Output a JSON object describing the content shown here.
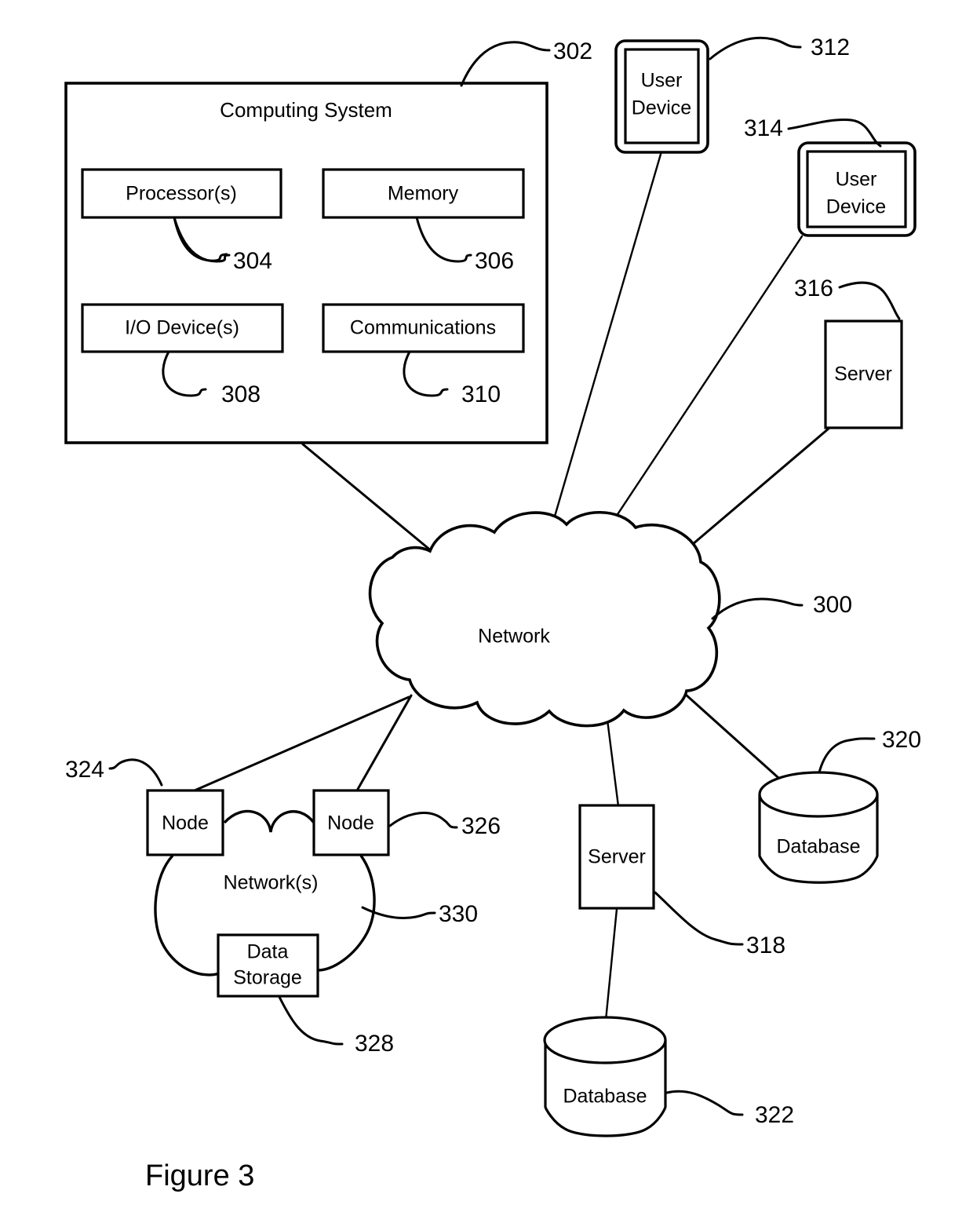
{
  "figure": {
    "caption": "Figure 3"
  },
  "computing_system": {
    "title": "Computing System",
    "ref": "302",
    "components": [
      {
        "label": "Processor(s)",
        "ref": "304"
      },
      {
        "label": "Memory",
        "ref": "306"
      },
      {
        "label": "I/O Device(s)",
        "ref": "308"
      },
      {
        "label": "Communications",
        "ref": "310"
      }
    ]
  },
  "user_devices": [
    {
      "line1": "User",
      "line2": "Device",
      "ref": "312"
    },
    {
      "line1": "User",
      "line2": "Device",
      "ref": "314"
    }
  ],
  "network": {
    "label": "Network",
    "ref": "300"
  },
  "servers": [
    {
      "label": "Server",
      "ref": "316"
    },
    {
      "label": "Server",
      "ref": "318"
    }
  ],
  "databases": [
    {
      "label": "Database",
      "ref": "320"
    },
    {
      "label": "Database",
      "ref": "322"
    }
  ],
  "sub_network": {
    "label": "Network(s)",
    "ref": "330",
    "nodes": [
      {
        "label": "Node",
        "ref": "324"
      },
      {
        "label": "Node",
        "ref": "326"
      }
    ],
    "data_storage": {
      "line1": "Data",
      "line2": "Storage",
      "ref": "328"
    }
  },
  "colors": {
    "stroke": "#000000",
    "background": "#ffffff"
  }
}
